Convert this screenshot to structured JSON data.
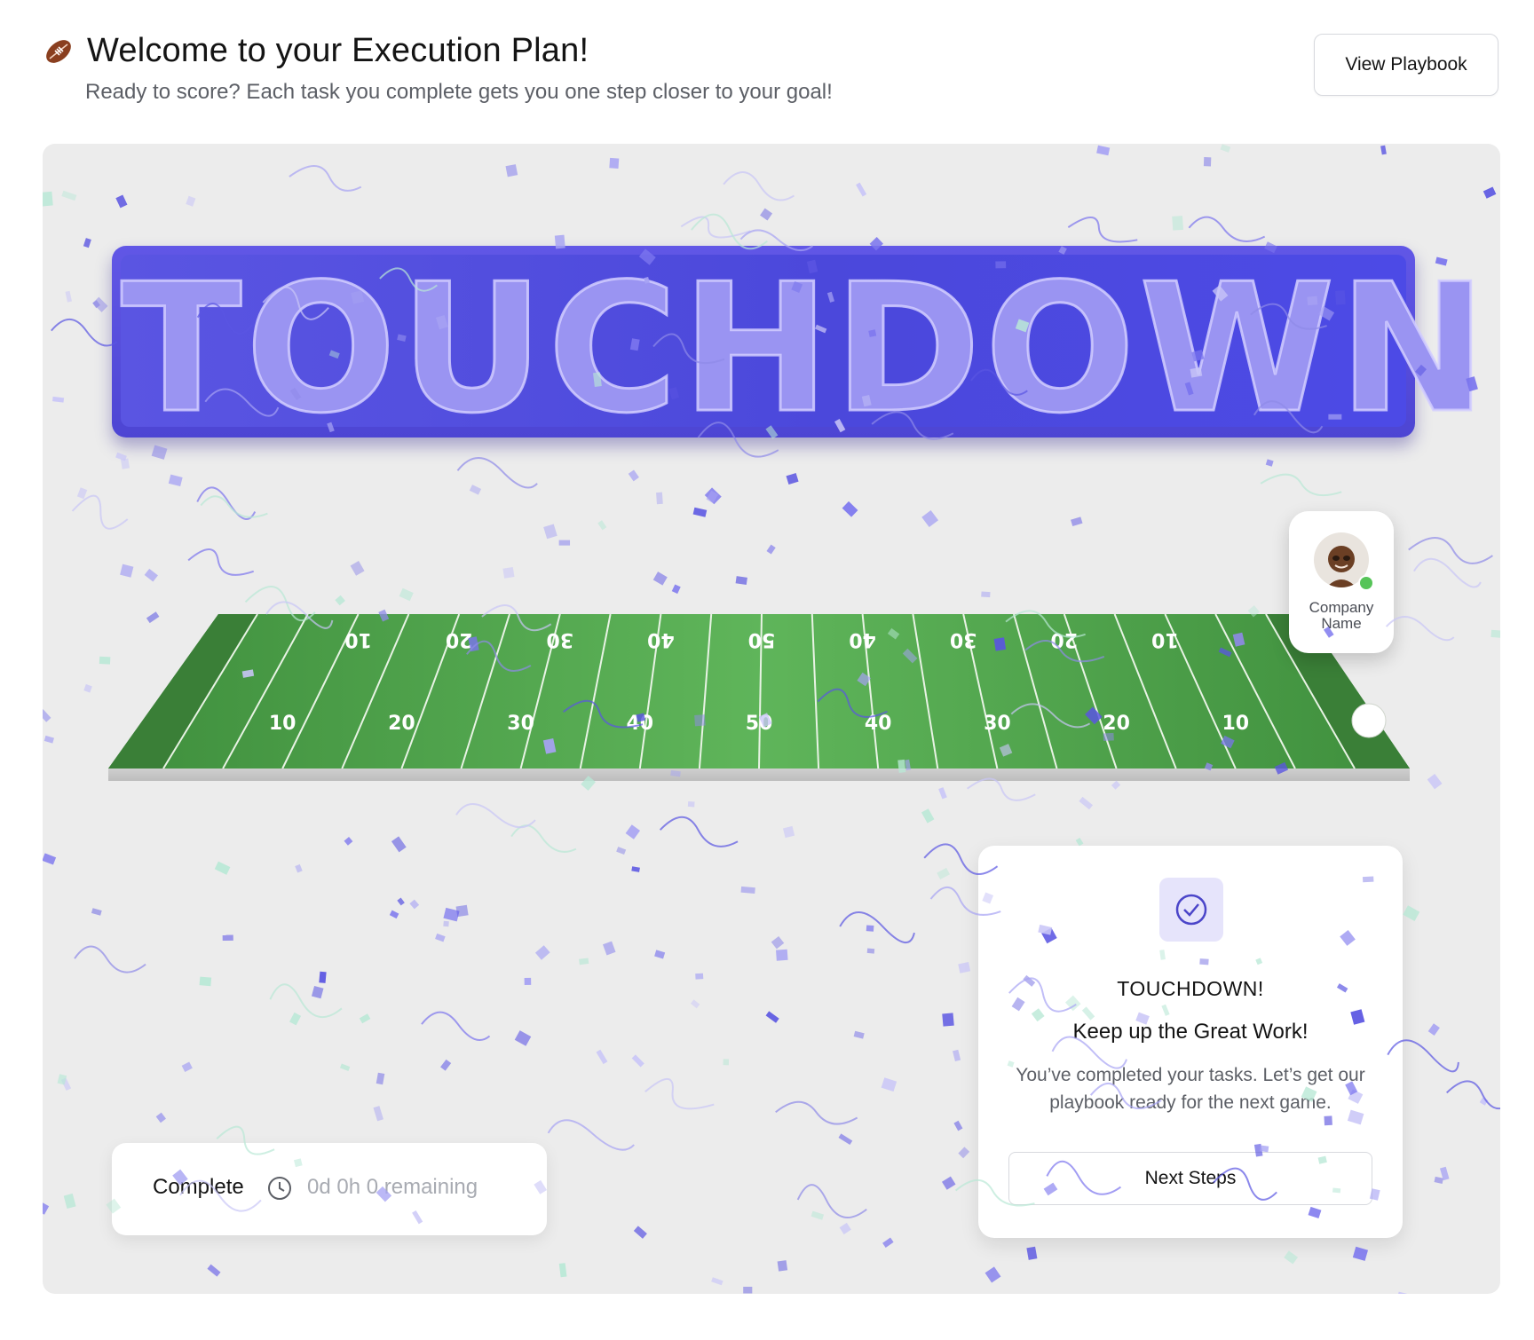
{
  "header": {
    "title": "Welcome to your Execution Plan!",
    "subtitle": "Ready to score? Each task you complete gets you one step closer to your goal!",
    "view_playbook_label": "View Playbook",
    "icon": "football-icon"
  },
  "banner": {
    "text": "TOUCHDOWN"
  },
  "field": {
    "top_numbers": [
      "10",
      "20",
      "30",
      "40",
      "50",
      "40",
      "30",
      "20",
      "10"
    ],
    "bottom_numbers": [
      "10",
      "20",
      "30",
      "40",
      "50",
      "40",
      "30",
      "20",
      "10"
    ],
    "ball_progress": 1.0
  },
  "company": {
    "name": "Company Name",
    "status": "online",
    "status_color": "#56c458"
  },
  "status_bar": {
    "label": "Complete",
    "remaining": "0d 0h 0 remaining",
    "icon": "clock-icon"
  },
  "touchdown_card": {
    "icon": "check-circle-icon",
    "title": "TOUCHDOWN!",
    "heading": "Keep up the Great Work!",
    "body": "You’ve completed your tasks. Let’s get our playbook ready for the next game.",
    "button_label": "Next Steps"
  },
  "colors": {
    "accent": "#5a55e2",
    "field_green": "#4da64a",
    "field_dark": "#3b8a3a",
    "stage_bg": "#ececec"
  }
}
